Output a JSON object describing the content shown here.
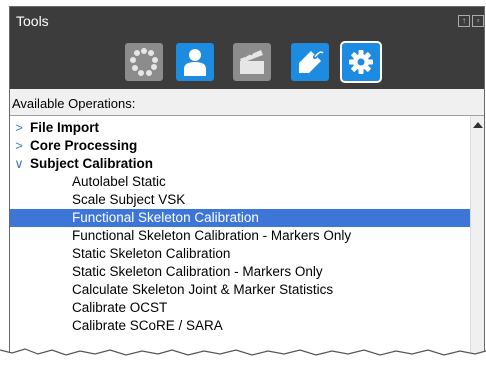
{
  "panel": {
    "title": "Tools"
  },
  "toolbar": {
    "tools": [
      {
        "icon": "circle-markers-icon",
        "color": "#8c8c8c"
      },
      {
        "icon": "person-icon",
        "color": "#1d8be0"
      },
      {
        "icon": "clapperboard-icon",
        "color": "#8c8c8c"
      },
      {
        "icon": "tag-icon",
        "color": "#1d8be0"
      },
      {
        "icon": "gear-icon",
        "color": "#1d8be0",
        "active": true
      }
    ]
  },
  "operations": {
    "label": "Available Operations:",
    "items": [
      {
        "type": "category",
        "label": "File Import",
        "expanded": false,
        "marker": ">"
      },
      {
        "type": "category",
        "label": "Core Processing",
        "expanded": false,
        "marker": ">"
      },
      {
        "type": "category",
        "label": "Subject Calibration",
        "expanded": true,
        "marker": "∨"
      },
      {
        "type": "operation",
        "label": "Autolabel Static"
      },
      {
        "type": "operation",
        "label": "Scale Subject VSK"
      },
      {
        "type": "operation",
        "label": "Functional Skeleton Calibration",
        "selected": true
      },
      {
        "type": "operation",
        "label": "Functional Skeleton Calibration - Markers Only"
      },
      {
        "type": "operation",
        "label": "Static Skeleton Calibration"
      },
      {
        "type": "operation",
        "label": "Static Skeleton Calibration - Markers Only"
      },
      {
        "type": "operation",
        "label": "Calculate Skeleton Joint & Marker Statistics"
      },
      {
        "type": "operation",
        "label": "Calibrate OCST"
      },
      {
        "type": "operation",
        "label": "Calibrate SCoRE / SARA"
      }
    ]
  },
  "colors": {
    "titlebar": "#3c3c3c",
    "accent": "#1d8be0",
    "selection": "#3d76d6"
  }
}
